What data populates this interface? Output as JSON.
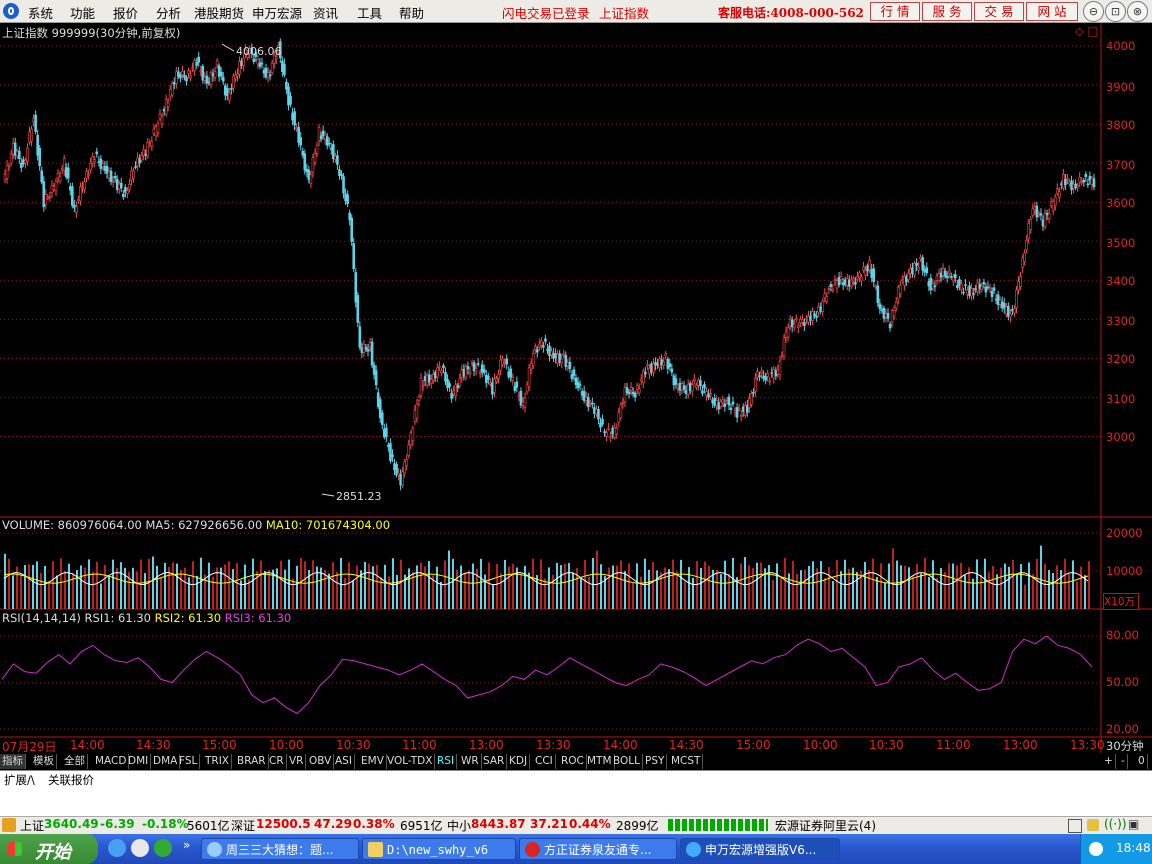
{
  "menu": {
    "items": [
      "系统",
      "功能",
      "报价",
      "分析",
      "港股期货",
      "申万宏源",
      "资讯",
      "工具",
      "帮助"
    ]
  },
  "header_links": {
    "flash_trade": "闪电交易已登录",
    "index_name": "上证指数"
  },
  "hotline": "客服电话:4008-000-562",
  "top_buttons": [
    "行 情",
    "服 务",
    "交 易",
    "网 站"
  ],
  "window_controls": {
    "min": "⊖",
    "max": "⊡",
    "close": "⊗"
  },
  "colors": {
    "up": "#ff4a4a",
    "down": "#5fd3e8",
    "grid": "#8a1a1a",
    "axis": "#b01818",
    "ma5": "#ffffff",
    "ma10": "#ffff00",
    "rsi": "#d02bd0"
  },
  "chart_header": {
    "title": "上证指数 999999(30分钟,前复权)",
    "icons": "◇ □"
  },
  "price_axis": [
    "4000",
    "3900",
    "3800",
    "3700",
    "3600",
    "3500",
    "3400",
    "3300",
    "3200",
    "3100",
    "3000"
  ],
  "annotations": {
    "high": "4006.06",
    "low": "2851.23"
  },
  "volume_info": {
    "volume": "VOLUME: 860976064.00",
    "ma5": "MA5: 627926656.00",
    "ma10": "MA10: 701674304.00"
  },
  "volume_axis": [
    "20000",
    "10000"
  ],
  "volume_unit": "X10万",
  "rsi_info": {
    "params": "RSI(14,14,14)",
    "rsi1": "RSI1: 61.30",
    "rsi2": "RSI2: 61.30",
    "rsi3": "RSI3: 61.30"
  },
  "rsi_axis": [
    "80.00",
    "50.00",
    "20.00"
  ],
  "time_axis": [
    "07月29日",
    "14:00",
    "14:30",
    "15:00",
    "10:00",
    "10:30",
    "11:00",
    "13:00",
    "13:30",
    "14:00",
    "14:30",
    "15:00",
    "10:00",
    "10:30",
    "11:00",
    "13:00",
    "13:30"
  ],
  "period_label": "30分钟",
  "indicator_tabs": [
    "指标",
    "模板",
    "全部",
    "MACD",
    "DMI",
    "DMA",
    "FSL",
    "TRIX",
    "BRAR",
    "CR",
    "VR",
    "OBV",
    "ASI",
    "EMV",
    "VOL-TDX",
    "RSI",
    "WR",
    "SAR",
    "KDJ",
    "CCI",
    "ROC",
    "MTM",
    "BOLL",
    "PSY",
    "MCST"
  ],
  "active_tab": "RSI",
  "tab_controls": [
    "+",
    "-",
    "0"
  ],
  "lower_tabs": [
    "扩展/\\",
    "关联报价"
  ],
  "status": {
    "sh_label": "上证",
    "sh_value": "3640.49",
    "sh_change": "-6.39",
    "sh_pct": "-0.18%",
    "sh_amount": "5601亿",
    "sz_label": "深证",
    "sz_value": "12500.5",
    "sz_change": "47.29",
    "sz_pct": "0.38%",
    "sz_amount": "6951亿",
    "zx_label": "中小",
    "zx_value": "8443.87",
    "zx_change": "37.21",
    "zx_pct": "0.44%",
    "zx_amount": "2899亿",
    "server": "宏源证券阿里云(4)"
  },
  "taskbar": {
    "start": "开始",
    "quick": "»",
    "tasks": [
      "周三三大猜想：题...",
      "D:\\new_swhy_v6",
      "方正证券泉友通专...",
      "申万宏源增强版V6..."
    ],
    "clock": "18:48"
  },
  "chart_data": {
    "type": "candlestick",
    "title": "上证指数 999999(30分钟,前复权)",
    "ylim": [
      2800,
      4050
    ],
    "annotations": [
      {
        "label": "4006.06",
        "type": "high"
      },
      {
        "label": "2851.23",
        "type": "low"
      }
    ],
    "close_series": [
      3650,
      3740,
      3690,
      3820,
      3600,
      3640,
      3700,
      3580,
      3660,
      3720,
      3680,
      3650,
      3620,
      3700,
      3730,
      3790,
      3850,
      3930,
      3920,
      3960,
      3900,
      3950,
      3870,
      3940,
      3990,
      3960,
      3920,
      4000,
      3860,
      3760,
      3650,
      3780,
      3750,
      3680,
      3560,
      3220,
      3230,
      3050,
      2950,
      2880,
      3000,
      3140,
      3150,
      3180,
      3100,
      3160,
      3180,
      3170,
      3120,
      3200,
      3140,
      3080,
      3220,
      3240,
      3200,
      3200,
      3150,
      3100,
      3070,
      3010,
      3010,
      3120,
      3110,
      3170,
      3180,
      3200,
      3130,
      3120,
      3140,
      3110,
      3080,
      3090,
      3060,
      3070,
      3160,
      3150,
      3170,
      3290,
      3290,
      3300,
      3320,
      3380,
      3400,
      3390,
      3410,
      3440,
      3330,
      3290,
      3390,
      3420,
      3450,
      3380,
      3420,
      3410,
      3380,
      3370,
      3390,
      3370,
      3330,
      3310,
      3450,
      3590,
      3550,
      3600,
      3660,
      3640,
      3660,
      3650
    ],
    "volume": {
      "last": 860976064.0,
      "ma5": 627926656.0,
      "ma10": 701674304.0,
      "axis_ticks": [
        10000,
        20000
      ],
      "unit": "X10万"
    },
    "rsi": {
      "params": [
        14,
        14,
        14
      ],
      "rsi1": 61.3,
      "rsi2": 61.3,
      "rsi3": 61.3,
      "axis_ticks": [
        20,
        50,
        80
      ],
      "values": [
        52,
        62,
        57,
        56,
        63,
        68,
        62,
        70,
        74,
        68,
        64,
        63,
        66,
        60,
        52,
        50,
        58,
        65,
        70,
        66,
        61,
        55,
        42,
        37,
        40,
        34,
        30,
        37,
        48,
        55,
        65,
        64,
        62,
        60,
        58,
        55,
        58,
        62,
        57,
        52,
        48,
        40,
        42,
        44,
        48,
        54,
        52,
        58,
        55,
        60,
        66,
        62,
        58,
        54,
        50,
        48,
        52,
        55,
        62,
        60,
        57,
        53,
        48,
        52,
        56,
        60,
        64,
        62,
        66,
        68,
        74,
        78,
        75,
        70,
        72,
        66,
        60,
        48,
        50,
        60,
        62,
        66,
        58,
        52,
        56,
        50,
        45,
        46,
        50,
        70,
        78,
        75,
        80,
        74,
        72,
        68,
        60
      ]
    }
  }
}
